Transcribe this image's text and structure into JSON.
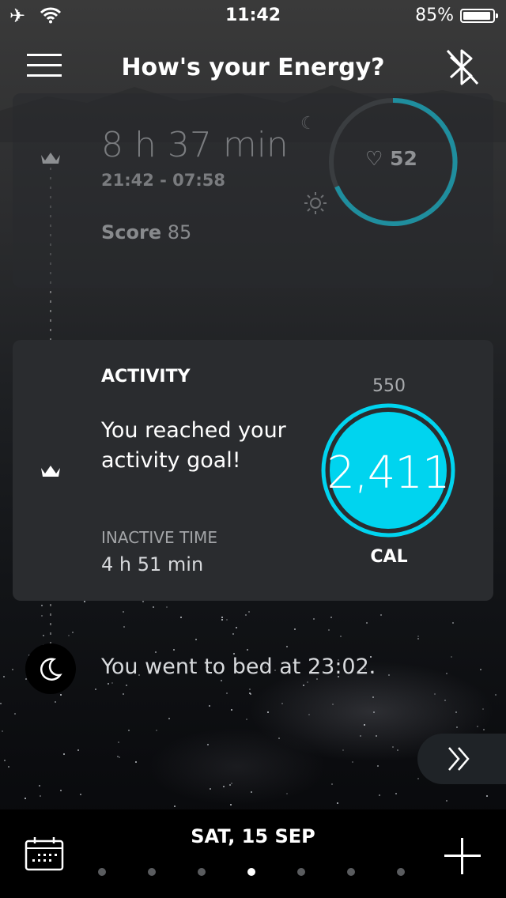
{
  "status": {
    "time": "11:42",
    "battery": "85%"
  },
  "header": {
    "title": "How's your Energy?"
  },
  "sleep": {
    "duration": "8 h 37 min",
    "range": "21:42 - 07:58",
    "score_label": "Score",
    "score_value": "85",
    "heart_rate": "52"
  },
  "activity": {
    "title": "ACTIVITY",
    "message": "You reached your activity goal!",
    "inactive_label": "INACTIVE TIME",
    "inactive_value": "4 h 51 min",
    "goal": "550",
    "calories": "2,411",
    "unit": "CAL"
  },
  "bed": {
    "text": "You went to bed at 23:02."
  },
  "footer": {
    "date": "SAT, 15 SEP",
    "pages": 7,
    "active_page": 4
  },
  "colors": {
    "accent": "#00d4ef",
    "ring_teal": "#1f8e9e"
  },
  "icons": [
    "airplane-icon",
    "wifi-icon",
    "battery-icon",
    "menu-icon",
    "bluetooth-icon",
    "crown-icon",
    "heart-icon",
    "moon-icon",
    "sun-icon",
    "double-chevron-right-icon",
    "calendar-icon",
    "plus-icon"
  ]
}
